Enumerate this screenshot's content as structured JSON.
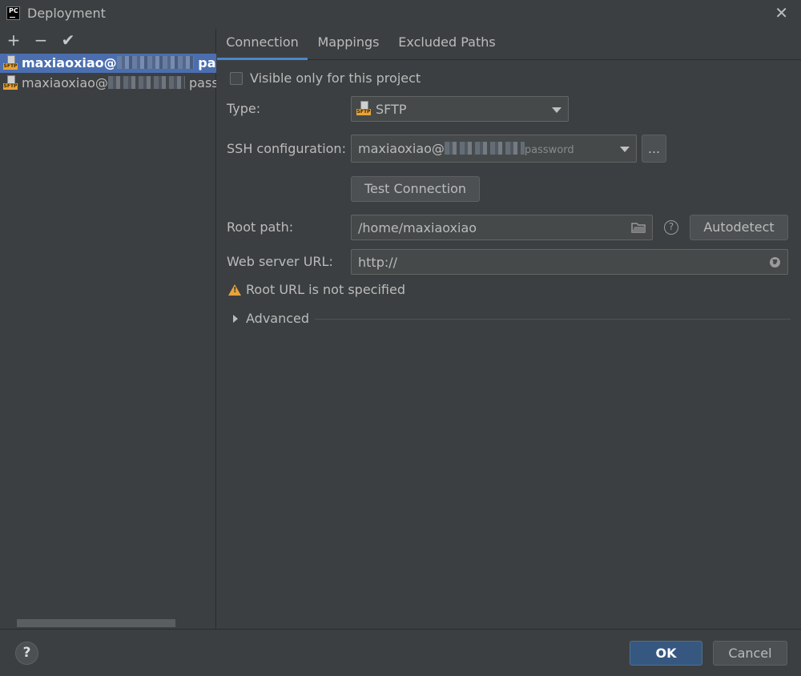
{
  "window": {
    "title": "Deployment",
    "close_glyph": "✕",
    "app_icon_text": "PC"
  },
  "left_toolbar": {
    "add": "+",
    "remove": "−",
    "apply": "✔"
  },
  "servers": [
    {
      "name_prefix": "maxiaoxiao@",
      "suffix": "pa",
      "selected": true,
      "icon": "sftp-server-default-icon"
    },
    {
      "name_prefix": "maxiaoxiao@",
      "suffix": "passv",
      "selected": false,
      "icon": "sftp-server-icon"
    }
  ],
  "tabs": [
    "Connection",
    "Mappings",
    "Excluded Paths"
  ],
  "active_tab": "Connection",
  "connection": {
    "visible_only_label": "Visible only for this project",
    "visible_only_checked": false,
    "type_label": "Type:",
    "type_value": "SFTP",
    "type_icon": "sftp-icon",
    "ssh_label": "SSH configuration:",
    "ssh_value_prefix": "maxiaoxiao@",
    "ssh_value_suffix": "password",
    "ssh_more": "...",
    "test_connection": "Test Connection",
    "root_path_label": "Root path:",
    "root_path_value": "/home/maxiaoxiao",
    "help_glyph": "?",
    "autodetect": "Autodetect",
    "web_url_label": "Web server URL:",
    "web_url_value": "http://",
    "warning_text": "Root URL is not specified",
    "advanced_label": "Advanced"
  },
  "footer": {
    "help_glyph": "?",
    "ok": "OK",
    "cancel": "Cancel"
  },
  "colors": {
    "background": "#3c3f41",
    "selection": "#4b6eaf",
    "tab_underline": "#4a88c7",
    "warning": "#e8a33b",
    "ok_button": "#365880"
  }
}
